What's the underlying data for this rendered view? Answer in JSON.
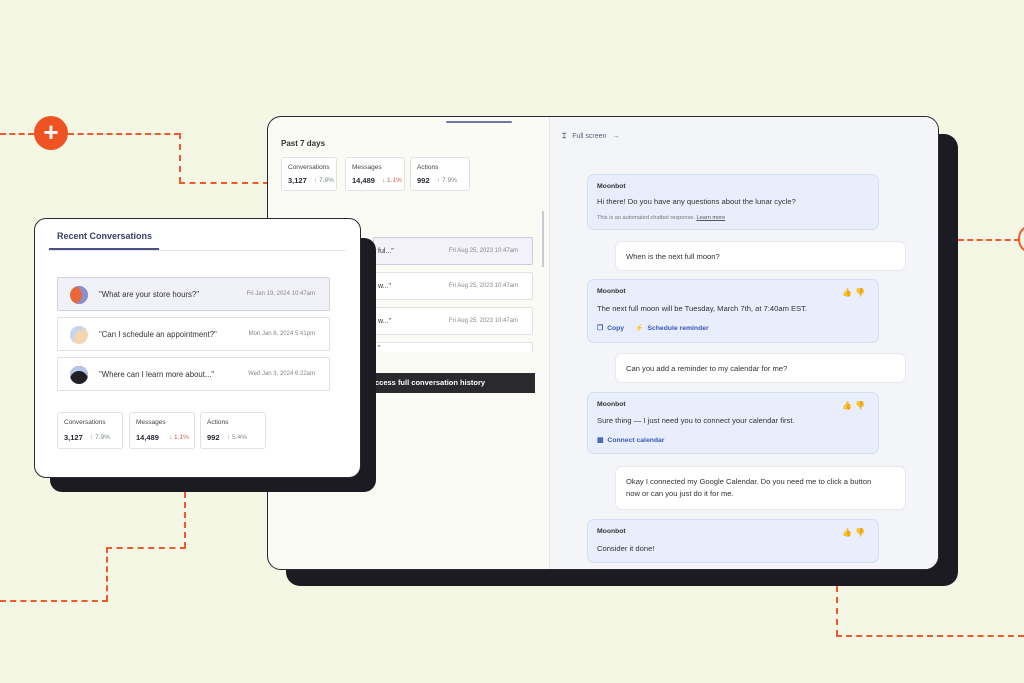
{
  "decor": {
    "plus_label": "+"
  },
  "dashboard": {
    "period": "Past 7 days",
    "stats": [
      {
        "label": "Conversations",
        "value": "3,127",
        "change": "↑ 7.9%"
      },
      {
        "label": "Messages",
        "value": "14,489",
        "change": "↓ 1.1%"
      },
      {
        "label": "Actions",
        "value": "992",
        "change": "↑ 7.9%"
      }
    ],
    "conversations": [
      {
        "question": "ful...\"",
        "date": "Fri Aug 25, 2023 10:47am"
      },
      {
        "question": "w...\"",
        "date": "Fri Aug 25, 2023 10:47am"
      },
      {
        "question": "w...\"",
        "date": "Fri Aug 25, 2023 10:47am"
      },
      {
        "question": "\"",
        "date": ""
      }
    ],
    "history_button": "ccess full conversation history"
  },
  "chat": {
    "fullscreen_label": "Full screen",
    "fullscreen_arrow": "→",
    "messages": [
      {
        "sender": "Moonbot",
        "text": "Hi there! Do you have any questions about the lunar cycle?",
        "note": "This is an automated chatbot response.",
        "note_link": "Learn more"
      },
      {
        "text": "When is the next full moon?"
      },
      {
        "sender": "Moonbot",
        "text": "The next full moon will be Tuesday, March 7th, at 7:40am EST.",
        "actions": [
          "Copy",
          "Schedule reminder"
        ]
      },
      {
        "text": "Can you add a reminder to my calendar for me?"
      },
      {
        "sender": "Moonbot",
        "text": "Sure thing — I just need you to connect your calendar first.",
        "actions": [
          "Connect calendar"
        ]
      },
      {
        "text_line1": "Okay I connected my Google Calendar. Do you need me to click a button",
        "text_line2": "now or can you just do it for me."
      },
      {
        "sender": "Moonbot",
        "text": "Consider it done!"
      }
    ]
  },
  "recent": {
    "title": "Recent Conversations",
    "rows": [
      {
        "question": "\"What are your store hours?\"",
        "date": "Fri Jan 19, 2024 10:47am",
        "avatar_color": "#e8683a"
      },
      {
        "question": "\"Can I schedule an appointment?\"",
        "date": "Mon Jan 8, 2024 5:41pm",
        "avatar_color": "#f3d6b0"
      },
      {
        "question": "\"Where can I learn more about...\"",
        "date": "Wed Jan 3, 2024 6:22am",
        "avatar_color": "#1f1f24"
      }
    ],
    "stats": [
      {
        "label": "Conversations",
        "value": "3,127",
        "change": "↑ 7.9%"
      },
      {
        "label": "Messages",
        "value": "14,489",
        "change": "↓ 1.1%"
      },
      {
        "label": "Actions",
        "value": "992",
        "change": "↑ 5.4%"
      }
    ]
  }
}
